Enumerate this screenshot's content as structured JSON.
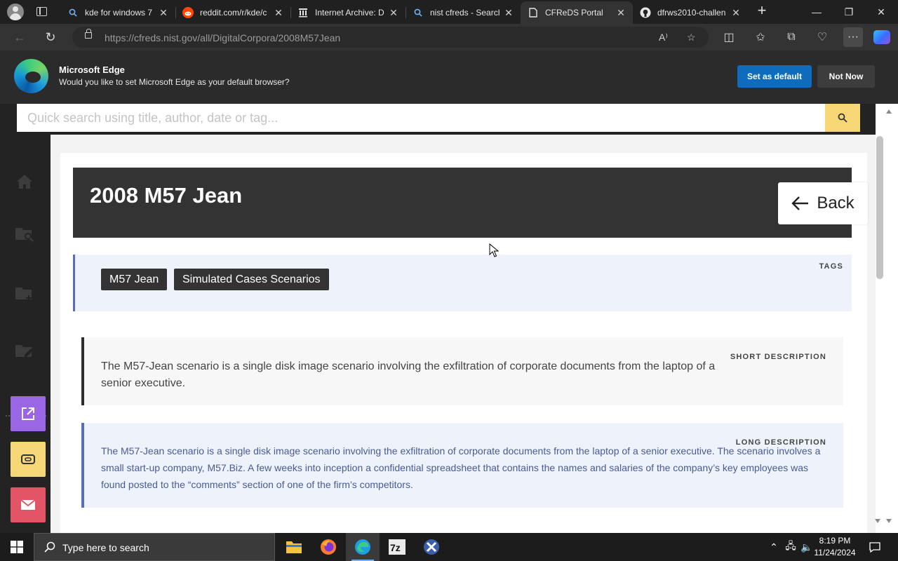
{
  "browser": {
    "tabs": [
      {
        "title": "kde for windows 7",
        "favicon": "search-icon",
        "active": false
      },
      {
        "title": "reddit.com/r/kde/c",
        "favicon": "reddit-icon",
        "active": false
      },
      {
        "title": "Internet Archive: Di",
        "favicon": "archive-icon",
        "active": false
      },
      {
        "title": "nist cfreds - Search",
        "favicon": "search-icon",
        "active": false
      },
      {
        "title": "CFReDS Portal",
        "favicon": "page-icon",
        "active": true
      },
      {
        "title": "dfrws2010-challen",
        "favicon": "github-icon",
        "active": false
      }
    ],
    "url": "https://cfreds.nist.gov/all/DigitalCorpora/2008M57Jean"
  },
  "banner": {
    "title": "Microsoft Edge",
    "message": "Would you like to set Microsoft Edge as your default browser?",
    "primary_label": "Set as default",
    "secondary_label": "Not Now"
  },
  "page": {
    "search_placeholder": "Quick search using title, author, date or tag...",
    "title": "2008 M57 Jean",
    "back_label": "Back",
    "tags_label": "TAGS",
    "tags": [
      "M57 Jean",
      "Simulated Cases Scenarios"
    ],
    "short_label": "SHORT DESCRIPTION",
    "short_description": "The M57-Jean scenario is a single disk image scenario involving the exfiltration of corporate documents from the laptop of a senior executive.",
    "long_label": "LONG DESCRIPTION",
    "long_description": "The M57-Jean scenario is a single disk image scenario involving the exfiltration of corporate documents from the laptop of a senior executive. The scenario involves a small start-up company, M57.Biz. A few weeks into inception a confidential spreadsheet that contains the names and salaries of the company’s key employees was found posted to the “comments” section of one of the firm’s competitors."
  },
  "taskbar": {
    "search_placeholder": "Type here to search",
    "time": "8:19 PM",
    "date": "11/24/2024"
  },
  "colors": {
    "accent_blue": "#0f6cbd",
    "search_button": "#f7d775",
    "title_bar": "#333333",
    "tags_bg": "#edf2fb",
    "long_text": "#4b5a96",
    "quick_purple": "#9a66e6",
    "quick_yellow": "#f6d778",
    "quick_pink": "#e45467"
  }
}
